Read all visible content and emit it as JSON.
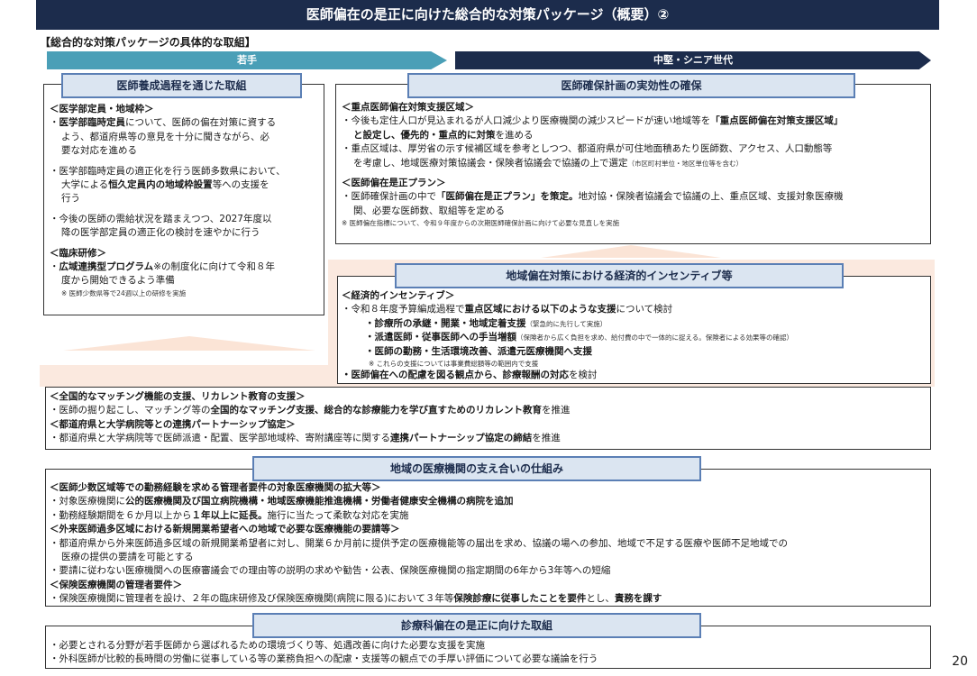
{
  "title": "医師偏在の是正に向けた総合的な対策パッケージ（概要）②",
  "subtitle": "【総合的な対策パッケージの具体的な取組】",
  "arrows": {
    "young": "若手",
    "senior": "中堅・シニア世代"
  },
  "training": {
    "header": "医師養成過程を通じた取組",
    "s1_title": "＜医学部定員・地域枠＞",
    "s1_i1_b": "医学部臨時定員",
    "s1_i1_a": "について、医師の偏在対策に資する",
    "s1_i1_l2": "よう、都道府県等の意見を十分に聞きながら、必",
    "s1_i1_l3": "要な対応を進める",
    "s1_i2_l1": "・医学部臨時定員の適正化を行う医師多数県において、",
    "s1_i2_l2a": "大学による",
    "s1_i2_l2b": "恒久定員内の地域枠設置",
    "s1_i2_l2c": "等への支援を",
    "s1_i2_l3": "行う",
    "s1_i3_l1": "・今後の医師の需給状況を踏まえつつ、2027年度以",
    "s1_i3_l2": "降の医学部定員の適正化の検討を速やかに行う",
    "s2_title": "＜臨床研修＞",
    "s2_i1_b": "広域連携型プログラム",
    "s2_i1_a": "※の制度化に向けて令和８年",
    "s2_i1_l2": "度から開始できるよう準備",
    "s2_note": "※ 医師少数県等で24週以上の研修を実施"
  },
  "plan": {
    "header": "医師確保計画の実効性の確保",
    "s1_title": "＜重点医師偏在対策支援区域＞",
    "s1_i1_a": "・今後も定住人口が見込まれるが人口減少より医療機関の減少スピードが速い地域等を",
    "s1_i1_b": "「重点医師偏在対策支援区域」",
    "s1_i1_l2": "と設定し、優先的・重点的に対策",
    "s1_i1_l2c": "を進める",
    "s1_i2_l1": "・重点区域は、厚労省の示す候補区域を参考としつつ、都道府県が可住地面積あたり医師数、アクセス、人口動態等",
    "s1_i2_l2": "を考慮し、地域医療対策協議会・保険者協議会で協議の上で選定",
    "s1_i2_l2s": "（市区町村単位・地区単位等を含む）",
    "s2_title": "＜医師偏在是正プラン＞",
    "s2_i1_a": "・医師確保計画の中で",
    "s2_i1_b": "「医師偏在是正プラン」を策定。",
    "s2_i1_c": "地対協・保険者協議会で協議の上、重点区域、支援対象医療機",
    "s2_i1_l2": "関、必要な医師数、取組等を定める",
    "note": "※ 医師偏在指標について、令和９年度からの次期医師確保計画に向けて必要な見直しを実施"
  },
  "incentive": {
    "header": "地域偏在対策における経済的インセンティブ等",
    "s1_title": "＜経済的インセンティブ＞",
    "i1_a": "・令和８年度予算編成過程で",
    "i1_b": "重点区域における以下のような支援",
    "i1_c": "について検討",
    "sub1_b": "・診療所の承継・開業・地域定着支援",
    "sub1_s": "（緊急的に先行して実施）",
    "sub2_b": "・派遣医師・従事医師への手当増額",
    "sub2_s": "（保険者から広く負担を求め、給付費の中で一体的に捉える。保険者による効果等の確認）",
    "sub3_b": "・医師の勤務・生活環境改善、派遣元医療機関へ支援",
    "sub_note": "※ これらの支援については事業費総額等の範囲内で支援",
    "i2_b": "・医師偏在への配慮を図る観点から、診療報酬の対応",
    "i2_c": "を検討"
  },
  "matching": {
    "t1": "＜全国的なマッチング機能の支援、リカレント教育の支援＞",
    "l1_a": "・医師の掘り起こし、マッチング等の",
    "l1_b": "全国的なマッチング支援、総合的な診療能力を学び直すためのリカレント教育",
    "l1_c": "を推進",
    "t2": "＜都道府県と大学病院等との連携パートナーシップ協定＞",
    "l2_a": "・都道府県と大学病院等で医師派遣・配置、医学部地域枠、寄附講座等に関する",
    "l2_b": "連携パートナーシップ協定の締結",
    "l2_c": "を推進"
  },
  "support": {
    "header": "地域の医療機関の支え合いの仕組み",
    "t1": "＜医師少数区域等での勤務経験を求める管理者要件の対象医療機関の拡大等＞",
    "l1_a": "・対象医療機関に",
    "l1_b": "公的医療機関及び国立病院機構・地域医療機能推進機構・労働者健康安全機構の病院を追加",
    "l2_a": "・勤務経験期間を６か月以上から",
    "l2_b": "１年以上に延長。",
    "l2_c": "施行に当たって柔軟な対応を実施",
    "t2": "＜外来医師過多区域における新規開業希望者への地域で必要な医療機能の要請等＞",
    "l3_1": "・都道府県から外来医師過多区域の新規開業希望者に対し、開業６か月前に提供予定の医療機能等の届出を求め、協議の場への参加、地域で不足する医療や医師不足地域での",
    "l3_2": "医療の提供の要請を可能とする",
    "l4": "・要請に従わない医療機関への医療審議会での理由等の説明の求めや勧告・公表、保険医療機関の指定期間の6年から3年等への短縮",
    "t3": "＜保険医療機関の管理者要件＞",
    "l5_a": "・保険医療機関に管理者を設け、２年の臨床研修及び保険医療機関(病院に限る)において３年等",
    "l5_b": "保険診療に従事したことを要件",
    "l5_c": "とし、",
    "l5_d": "責務を課す"
  },
  "dental": {
    "header": "診療科偏在の是正に向けた取組",
    "l1": "・必要とされる分野が若手医師から選ばれるための環境づくり等、処遇改善に向けた必要な支援を実施",
    "l2": "・外科医師が比較的長時間の労働に従事している等の業務負担への配慮・支援等の観点での手厚い評価について必要な議論を行う"
  },
  "page_number": "20"
}
